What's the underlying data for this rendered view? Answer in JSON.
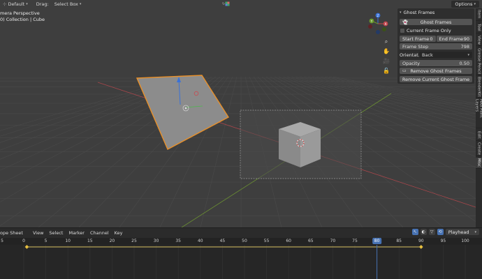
{
  "header": {
    "workspace": "Default",
    "drag_label": "Drag:",
    "drag_value": "Select Box",
    "options_label": "Options"
  },
  "overlay": {
    "view_name": "mera Perspective",
    "collection": "0) Collection | Cube"
  },
  "panel": {
    "title": "Ghost Frames",
    "ghost_button": "Ghost Frames",
    "current_frame_only": "Current Frame Only",
    "start_frame_label": "Start Frame",
    "start_frame_value": "0",
    "end_frame_label": "End Frame",
    "end_frame_value": "90",
    "frame_step_label": "Frame Step",
    "frame_step_value": "798",
    "orientation_label": "Orientat...",
    "orientation_value": "Back",
    "opacity_label": "Opacity",
    "opacity_value": "0.50",
    "remove_button": "Remove Ghost Frames",
    "remove_current_button": "Remove Current Ghost Frame"
  },
  "tabs": [
    "Item",
    "Tool",
    "View",
    "Grease Pencil",
    "BlenderKit",
    "HAS Paint Layers",
    "Edit",
    "Create",
    "Misc"
  ],
  "gizmo": {
    "x": "X",
    "y": "Y",
    "z": "Z"
  },
  "timeline": {
    "editor": "ope Sheet",
    "menus": [
      "View",
      "Select",
      "Marker",
      "Channel",
      "Key"
    ],
    "playhead_label": "Playhead",
    "current_frame": "80",
    "ticks": [
      "5",
      "0",
      "5",
      "10",
      "15",
      "20",
      "25",
      "30",
      "35",
      "40",
      "45",
      "50",
      "55",
      "60",
      "65",
      "70",
      "75",
      "85",
      "90",
      "95",
      "100"
    ]
  },
  "colors": {
    "accent": "#4772b3",
    "selection_outline": "#e8902a",
    "x_axis": "#c0454c",
    "y_axis": "#6a9a2a",
    "z_axis": "#3a72d8"
  }
}
